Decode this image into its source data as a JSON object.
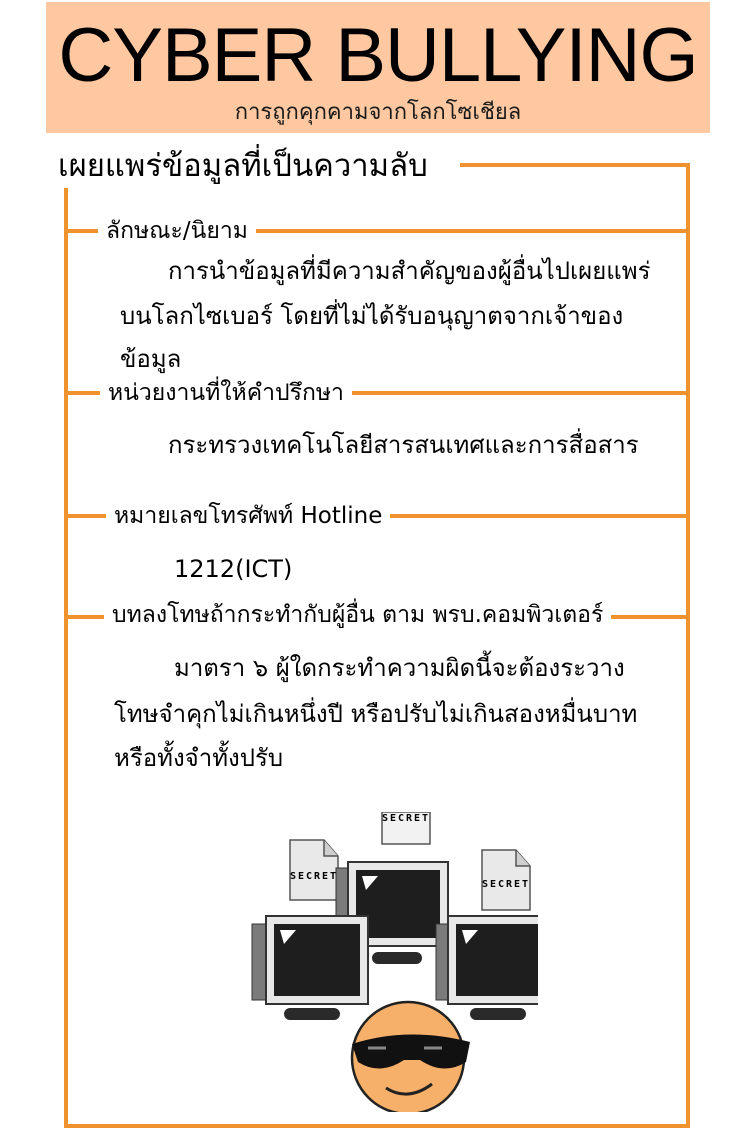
{
  "banner": {
    "title": "CYBER BULLYING",
    "subtitle": "การถูกคุกคามจากโลกโซเชียล"
  },
  "heading": "เผยแพร่ข้อมูลที่เป็นความลับ",
  "sections": [
    {
      "label": "ลักษณะ/นิยาม",
      "body_line1": "การนำข้อมูลที่มีความสำคัญของผู้อื่นไปเผยแพร่",
      "body_line2": "บนโลกไซเบอร์ โดยที่ไม่ได้รับอนุญาตจากเจ้าของ",
      "body_line3": "ข้อมูล"
    },
    {
      "label": "หน่วยงานที่ให้คำปรึกษา",
      "body_line1": "กระทรวงเทคโนโลยีสารสนเทศและการสื่อสาร"
    },
    {
      "label": "หมายเลขโทรศัพท์ Hotline",
      "body_line1": "1212(ICT)"
    },
    {
      "label": "บทลงโทษถ้ากระทำกับผู้อื่น ตาม พรบ.คอมพิวเตอร์",
      "body_line1": "มาตรา ๖ ผู้ใดกระทำความผิดนี้จะต้องระวาง",
      "body_line2": "โทษจำคุกไม่เกินหนึ่งปี หรือปรับไม่เกินสองหมื่นบาท",
      "body_line3": "หรือทั้งจำทั้งปรับ"
    }
  ],
  "illustration": {
    "doc_label": "SECRET",
    "colors": {
      "frame": "#f0922e",
      "banner": "#ffc8a0",
      "face": "#f7b06a"
    }
  }
}
